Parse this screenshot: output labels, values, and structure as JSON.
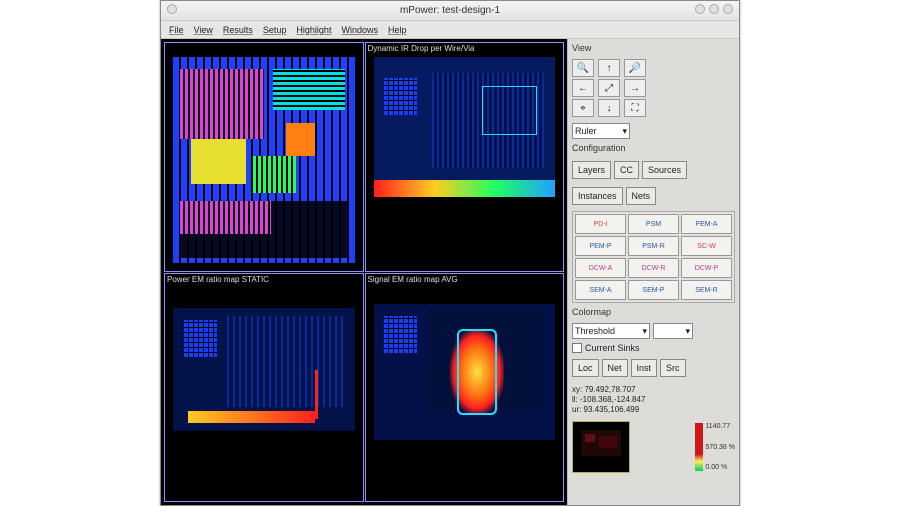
{
  "window": {
    "title": "mPower: test-design-1"
  },
  "menu": {
    "file": "File",
    "view": "View",
    "results": "Results",
    "setup": "Setup",
    "highlight": "Highlight",
    "windows": "Windows",
    "help": "Help"
  },
  "panes": {
    "tl_label": "",
    "tr_label": "Dynamic IR Drop per Wire/Via",
    "bl_label": "Power EM ratio map STATIC",
    "br_label": "Signal EM ratio map AVG"
  },
  "sidebar": {
    "view_title": "View",
    "ruler_label": "Ruler",
    "config_title": "Configuration",
    "btn_layers": "Layers",
    "btn_cc": "CC",
    "btn_sources": "Sources",
    "btn_instances": "Instances",
    "btn_nets": "Nets",
    "modes": [
      "PD-I",
      "PSM",
      "PEM-A",
      "PEM-P",
      "PSM-R",
      "SC-W",
      "DCW-A",
      "DCW-R",
      "DCW-P",
      "SEM-A",
      "SEM-P",
      "SEM-R"
    ],
    "colormap_title": "Colormap",
    "colormap_value": "Threshold",
    "current_sinks": "Current Sinks",
    "btn_loc": "Loc",
    "btn_net": "Net",
    "btn_inst": "Inst",
    "btn_src": "Src",
    "coords": {
      "xy": "xy: 79.492,78.707",
      "ll": "ll: -108.368,-124.847",
      "ur": "ur: 93.435,106.499"
    },
    "legend": {
      "hi": "1140.77",
      "mid": "570.38 %",
      "lo": "0.00 %"
    }
  }
}
